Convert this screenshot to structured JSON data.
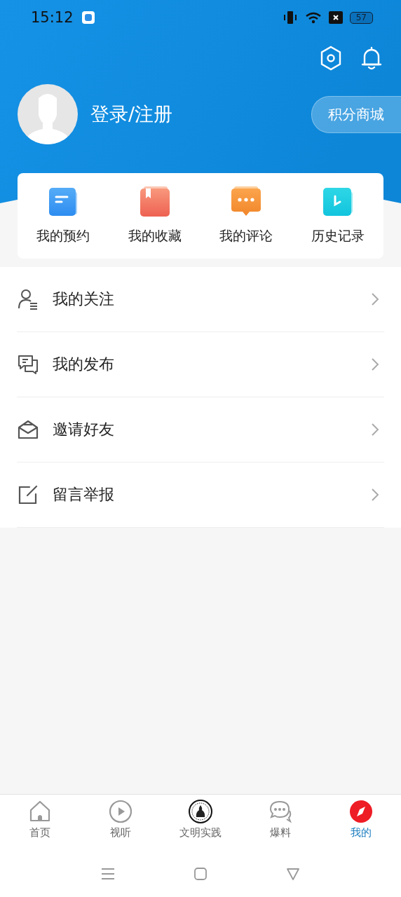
{
  "status_bar": {
    "time": "15:12",
    "battery": "57"
  },
  "profile": {
    "login_label": "登录/注册",
    "points_mall": "积分商城"
  },
  "quick_actions": [
    {
      "kind": "booking",
      "label": "我的预约"
    },
    {
      "kind": "favorites",
      "label": "我的收藏"
    },
    {
      "kind": "comments",
      "label": "我的评论"
    },
    {
      "kind": "history",
      "label": "历史记录"
    }
  ],
  "menu": [
    {
      "kind": "following",
      "label": "我的关注"
    },
    {
      "kind": "posts",
      "label": "我的发布"
    },
    {
      "kind": "invite",
      "label": "邀请好友"
    },
    {
      "kind": "report",
      "label": "留言举报"
    }
  ],
  "bottom_nav": [
    {
      "kind": "home",
      "label": "首页",
      "selected": false
    },
    {
      "kind": "play",
      "label": "视听",
      "selected": false
    },
    {
      "kind": "emblem",
      "label": "文明实践",
      "selected": false
    },
    {
      "kind": "chat",
      "label": "爆料",
      "selected": false
    },
    {
      "kind": "mine",
      "label": "我的",
      "selected": true
    }
  ]
}
